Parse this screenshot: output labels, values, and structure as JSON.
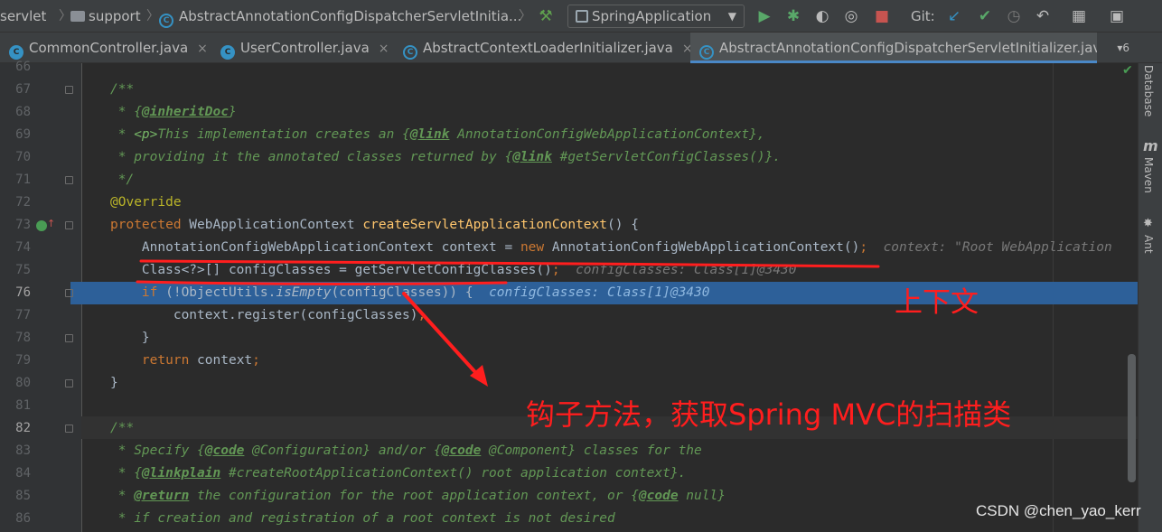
{
  "breadcrumb": {
    "items": [
      "servlet",
      "support",
      "AbstractAnnotationConfigDispatcherServletInitia..."
    ]
  },
  "toolbar": {
    "run_config": "SpringApplication",
    "git_label": "Git:"
  },
  "tabs": [
    {
      "label": "CommonController.java",
      "active": false
    },
    {
      "label": "UserController.java",
      "active": false
    },
    {
      "label": "AbstractContextLoaderInitializer.java",
      "active": false
    },
    {
      "label": "AbstractAnnotationConfigDispatcherServletInitializer.java",
      "active": true
    }
  ],
  "tab_overflow": "6",
  "right_tools": [
    "Database",
    "Maven",
    "Ant"
  ],
  "editor": {
    "lines": [
      {
        "n": "66"
      },
      {
        "n": "67",
        "code": "/**"
      },
      {
        "n": "68",
        "code": " * {@inheritDoc}"
      },
      {
        "n": "69",
        "code": " * <p>This implementation creates an {@link AnnotationConfigWebApplicationContext},"
      },
      {
        "n": "70",
        "code": " * providing it the annotated classes returned by {@link #getServletConfigClasses()}."
      },
      {
        "n": "71",
        "code": " */"
      },
      {
        "n": "72",
        "code": "@Override"
      },
      {
        "n": "73",
        "code": "protected WebApplicationContext createServletApplicationContext() {"
      },
      {
        "n": "74",
        "code": "AnnotationConfigWebApplicationContext context = new AnnotationConfigWebApplicationContext();",
        "hint": "context: \"Root WebApplication"
      },
      {
        "n": "75",
        "code": "Class<?>[] configClasses = getServletConfigClasses();",
        "hint": "configClasses: Class[1]@3430"
      },
      {
        "n": "76",
        "code": "if (!ObjectUtils.isEmpty(configClasses)) {",
        "hint": "configClasses: Class[1]@3430"
      },
      {
        "n": "77",
        "code": "context.register(configClasses);"
      },
      {
        "n": "78",
        "code": "}"
      },
      {
        "n": "79",
        "code": "return context;"
      },
      {
        "n": "80",
        "code": "}"
      },
      {
        "n": "81"
      },
      {
        "n": "82",
        "code": "/**"
      },
      {
        "n": "83",
        "code": " * Specify {@code @Configuration} and/or {@code @Component} classes for the"
      },
      {
        "n": "84",
        "code": " * {@linkplain #createRootApplicationContext() root application context}."
      },
      {
        "n": "85",
        "code": " * @return the configuration for the root application context, or {@code null}"
      },
      {
        "n": "86",
        "code": " * if creation and registration of a root context is not desired"
      }
    ]
  },
  "annotations": {
    "context_label": "上下文",
    "hook_label": "钩子方法，获取Spring MVC的扫描类",
    "color": "#ff1e1e"
  },
  "watermark": "CSDN @chen_yao_kerr",
  "colors": {
    "background": "#2b2b2b",
    "keyword": "#cc7832",
    "comment": "#629755",
    "method": "#ffc66d",
    "annotation": "#bbb529",
    "selection": "#2d6099"
  }
}
